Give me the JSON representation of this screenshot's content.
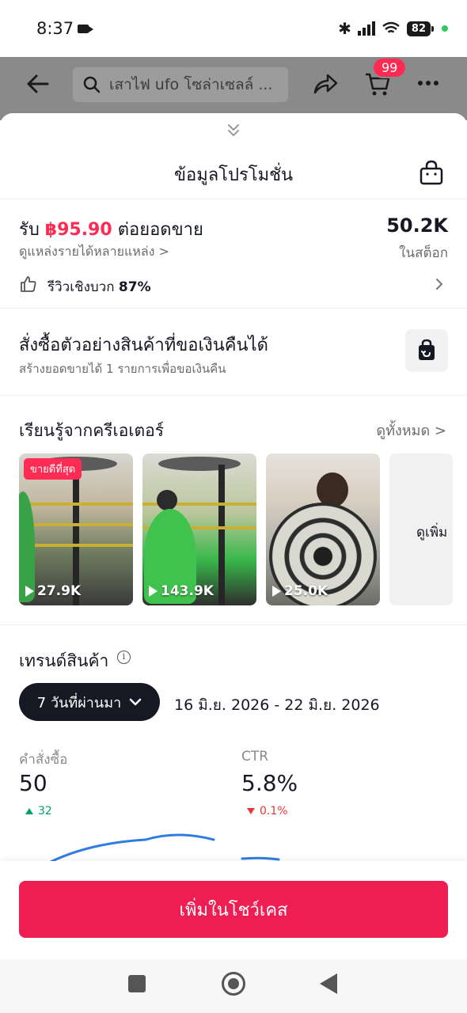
{
  "status_bar": {
    "time": "8:37",
    "battery": "82"
  },
  "header": {
    "search_placeholder": "เสาไฟ ufo โซล่าเซลล์ ...",
    "cart_count": "99"
  },
  "sheet": {
    "title": "ข้อมูลโปรโมชั่น"
  },
  "earnings": {
    "prefix": "รับ",
    "amount": "฿95.90",
    "suffix": "ต่อยอดขาย",
    "sources_link": "ดูแหล่งรายได้หลายแหล่ง >",
    "stock_value": "50.2K",
    "stock_label": "ในสต็อก",
    "review_label": "รีวิวเชิงบวก",
    "review_value": "87%"
  },
  "sample": {
    "title": "สั่งซื้อตัวอย่างสินค้าที่ขอเงินคืนได้",
    "subtitle": "สร้างยอดขายได้ 1 รายการเพื่อขอเงินคืน"
  },
  "creators": {
    "title": "เรียนรู้จากครีเอเตอร์",
    "see_all": "ดูทั้งหมด >",
    "videos": [
      {
        "views": "27.9K",
        "badge": "ขายดีที่สุด"
      },
      {
        "views": "143.9K"
      },
      {
        "views": "25.0K"
      }
    ],
    "more_label": "ดูเพิ่ม"
  },
  "trend": {
    "title": "เทรนด์สินค้า",
    "period": "7 วันที่ผ่านมา",
    "date_range": "16 มิ.ย. 2026 - 22 มิ.ย. 2026",
    "metrics": [
      {
        "label": "คำสั่งซื้อ",
        "value": "50",
        "delta": "32",
        "direction": "up"
      },
      {
        "label": "CTR",
        "value": "5.8%",
        "delta": "0.1%",
        "direction": "down"
      }
    ]
  },
  "cta": {
    "label": "เพิ่มในโชว์เคส"
  },
  "colors": {
    "accent": "#fe2c55",
    "cta": "#ee1d52",
    "positive": "#00a36c",
    "negative": "#e53935",
    "sparkline": "#2f7de1"
  },
  "icons": [
    "back-arrow-icon",
    "search-icon",
    "share-icon",
    "cart-icon",
    "more-icon",
    "collapse-chevron-icon",
    "shopping-bag-icon",
    "thumbs-up-icon",
    "chevron-right-icon",
    "refund-bag-icon",
    "play-icon",
    "info-icon",
    "chevron-down-icon",
    "trend-up-icon",
    "trend-down-icon"
  ]
}
